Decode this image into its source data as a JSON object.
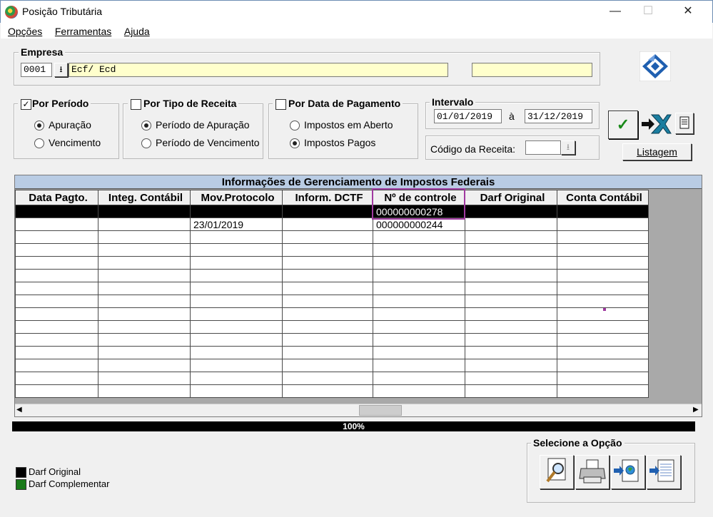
{
  "window": {
    "title": "Posição Tributária",
    "minimize": "—",
    "maximize": "☐",
    "close": "✕"
  },
  "menu": {
    "items": [
      {
        "label": "Opções"
      },
      {
        "label": "Ferramentas"
      },
      {
        "label": "Ajuda"
      }
    ]
  },
  "empresa": {
    "group_label": "Empresa",
    "code": "0001",
    "name": "Ecf/ Ecd",
    "extra": ""
  },
  "filters": {
    "por_periodo": {
      "label": "Por Período",
      "checked": true,
      "options": [
        "Apuração",
        "Vencimento"
      ],
      "selected": "Apuração"
    },
    "por_tipo": {
      "label": "Por Tipo de Receita",
      "checked": false,
      "options": [
        "Período de Apuração",
        "Período de Vencimento"
      ],
      "selected": "Período de Apuração"
    },
    "por_data": {
      "label": "Por Data de Pagamento",
      "checked": false,
      "options": [
        "Impostos em Aberto",
        "Impostos Pagos"
      ],
      "selected": "Impostos Pagos"
    }
  },
  "intervalo": {
    "label": "Intervalo",
    "from": "01/01/2019",
    "sep": "à",
    "to": "31/12/2019"
  },
  "codigo_receita": {
    "label": "Código da Receita:",
    "value": ""
  },
  "buttons": {
    "listagem": "Listagem"
  },
  "grid": {
    "title": "Informações de Gerenciamento de Impostos Federais",
    "columns": [
      "Data Pagto.",
      "Integ. Contábil",
      "Mov.Protocolo",
      "Inform. DCTF",
      "Nº de controle",
      "Darf Original",
      "Conta Contábil"
    ],
    "rows": [
      [
        "",
        "",
        "",
        "",
        "000000000278",
        "",
        ""
      ],
      [
        "",
        "",
        "23/01/2019",
        "",
        "000000000244",
        "",
        ""
      ]
    ],
    "empty_rows": 13
  },
  "progress": {
    "label": "100%",
    "value": 1.0
  },
  "legend": [
    {
      "label": "Darf Original",
      "color": "#000000"
    },
    {
      "label": "Darf Complementar",
      "color": "#1a7a1a"
    }
  ],
  "selecione": {
    "label": "Selecione a Opção"
  },
  "colors": {
    "highlight": "#a03aa0",
    "grid_title_bg": "#b9cce4",
    "field_yellow": "#ffffcc"
  }
}
